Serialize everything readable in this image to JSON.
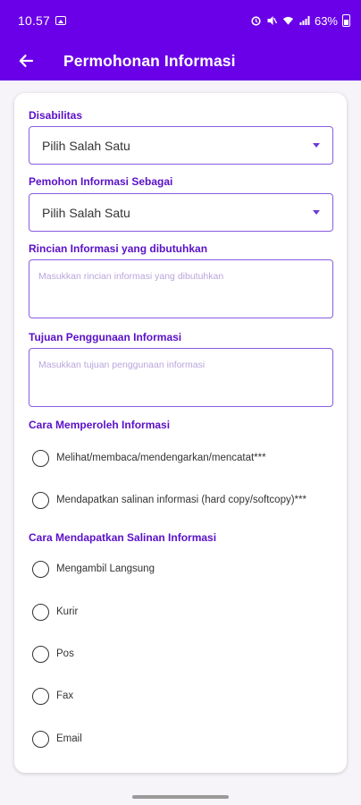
{
  "status": {
    "time": "10.57",
    "battery": "63%"
  },
  "app": {
    "title": "Permohonan Informasi"
  },
  "form": {
    "disabilitas": {
      "label": "Disabilitas",
      "value": "Pilih Salah Satu"
    },
    "pemohon": {
      "label": "Pemohon Informasi Sebagai",
      "value": "Pilih Salah Satu"
    },
    "rincian": {
      "label": "Rincian Informasi yang dibutuhkan",
      "placeholder": "Masukkan rincian informasi yang dibutuhkan"
    },
    "tujuan": {
      "label": "Tujuan Penggunaan Informasi",
      "placeholder": "Masukkan tujuan penggunaan informasi"
    },
    "cara_memperoleh": {
      "label": "Cara Memperoleh Informasi",
      "options": [
        "Melihat/membaca/mendengarkan/mencatat***",
        "Mendapatkan salinan informasi (hard copy/softcopy)***"
      ]
    },
    "cara_salinan": {
      "label": "Cara Mendapatkan Salinan Informasi",
      "options": [
        "Mengambil Langsung",
        "Kurir",
        "Pos",
        "Fax",
        "Email"
      ]
    }
  },
  "colors": {
    "primary": "#6a00e8",
    "label": "#5a10c8",
    "border": "#8a5ce0"
  }
}
